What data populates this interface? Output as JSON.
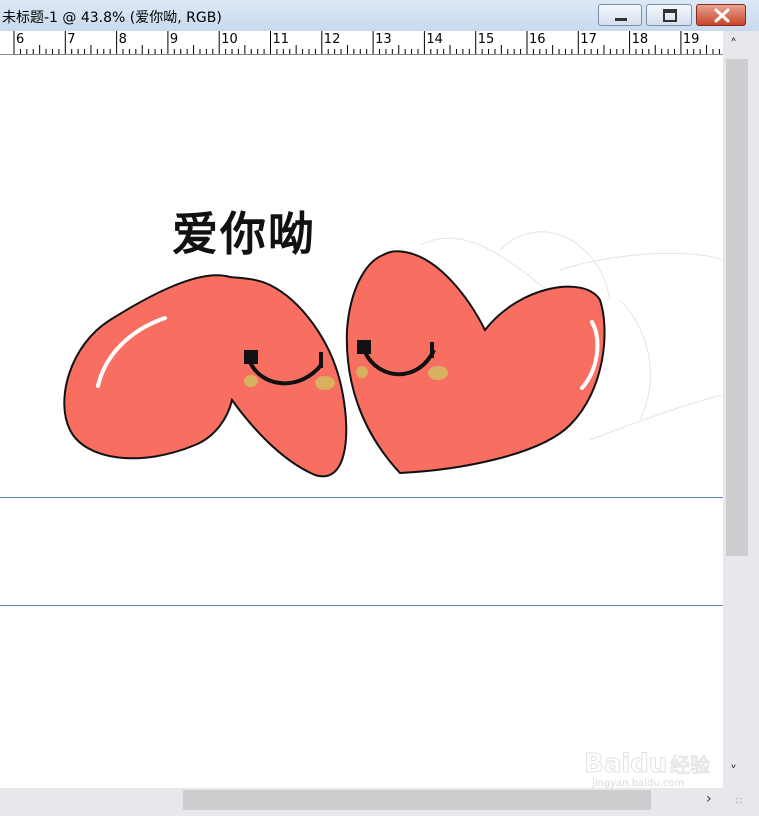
{
  "window": {
    "title": "未标题-1 @ 43.8% (爱你呦, RGB)"
  },
  "ruler": {
    "labels": [
      "6",
      "7",
      "8",
      "9",
      "10",
      "11",
      "12",
      "13",
      "14",
      "15",
      "16",
      "17",
      "18",
      "19"
    ]
  },
  "canvas": {
    "text_layer": "爱你呦",
    "heart_color": "#f86f62",
    "cheek_color": "#d7b060"
  },
  "watermark": {
    "brand": "Baidu",
    "brand_cn": "经验",
    "url": "jingyan.baidu.com"
  }
}
